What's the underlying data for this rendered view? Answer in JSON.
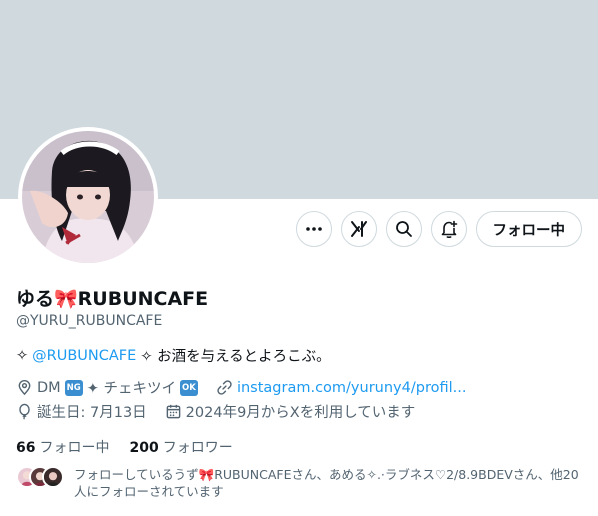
{
  "profile": {
    "display_name": "ゆる🎀RUBUNCAFE",
    "handle": "@YURU_RUBUNCAFE",
    "bio": {
      "prefix": "✧",
      "mention": "@RUBUNCAFE",
      "text": "✧ お酒を与えるとよろこぶ。"
    },
    "location": "DM",
    "location_badge": "NG",
    "location_mid": "✦ チェキツイ",
    "location_badge2": "OK",
    "website": "instagram.com/yuruny4/profil...",
    "birthday": "誕生日: 7月13日",
    "joined": "2024年9月からXを利用しています"
  },
  "stats": {
    "following_count": "66",
    "following_label": "フォロー中",
    "followers_count": "200",
    "followers_label": "フォロワー"
  },
  "followed_by": {
    "text": "フォローしているうず🎀RUBUNCAFEさん、あめる✧.·ラブネス♡2/8.9BDEVさん、他20人にフォローされています"
  },
  "actions": {
    "follow_label": "フォロー中"
  },
  "icons": {
    "more": "more-icon",
    "grok": "grok-icon",
    "search": "search-icon",
    "notify": "notification-bell-icon",
    "location": "location-pin-icon",
    "link": "link-icon",
    "birthday": "balloon-icon",
    "calendar": "calendar-icon"
  },
  "colors": {
    "banner": "#cfd9de",
    "accent": "#1d9bf0",
    "muted": "#536471"
  }
}
